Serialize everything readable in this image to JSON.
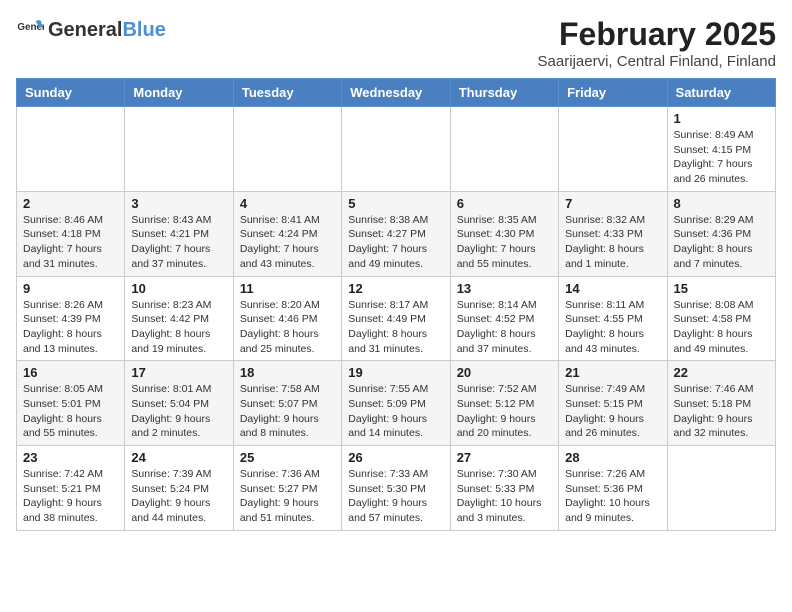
{
  "logo": {
    "general": "General",
    "blue": "Blue"
  },
  "title": "February 2025",
  "subtitle": "Saarijaervi, Central Finland, Finland",
  "days_of_week": [
    "Sunday",
    "Monday",
    "Tuesday",
    "Wednesday",
    "Thursday",
    "Friday",
    "Saturday"
  ],
  "weeks": [
    [
      {
        "day": "",
        "info": ""
      },
      {
        "day": "",
        "info": ""
      },
      {
        "day": "",
        "info": ""
      },
      {
        "day": "",
        "info": ""
      },
      {
        "day": "",
        "info": ""
      },
      {
        "day": "",
        "info": ""
      },
      {
        "day": "1",
        "info": "Sunrise: 8:49 AM\nSunset: 4:15 PM\nDaylight: 7 hours and 26 minutes."
      }
    ],
    [
      {
        "day": "2",
        "info": "Sunrise: 8:46 AM\nSunset: 4:18 PM\nDaylight: 7 hours and 31 minutes."
      },
      {
        "day": "3",
        "info": "Sunrise: 8:43 AM\nSunset: 4:21 PM\nDaylight: 7 hours and 37 minutes."
      },
      {
        "day": "4",
        "info": "Sunrise: 8:41 AM\nSunset: 4:24 PM\nDaylight: 7 hours and 43 minutes."
      },
      {
        "day": "5",
        "info": "Sunrise: 8:38 AM\nSunset: 4:27 PM\nDaylight: 7 hours and 49 minutes."
      },
      {
        "day": "6",
        "info": "Sunrise: 8:35 AM\nSunset: 4:30 PM\nDaylight: 7 hours and 55 minutes."
      },
      {
        "day": "7",
        "info": "Sunrise: 8:32 AM\nSunset: 4:33 PM\nDaylight: 8 hours and 1 minute."
      },
      {
        "day": "8",
        "info": "Sunrise: 8:29 AM\nSunset: 4:36 PM\nDaylight: 8 hours and 7 minutes."
      }
    ],
    [
      {
        "day": "9",
        "info": "Sunrise: 8:26 AM\nSunset: 4:39 PM\nDaylight: 8 hours and 13 minutes."
      },
      {
        "day": "10",
        "info": "Sunrise: 8:23 AM\nSunset: 4:42 PM\nDaylight: 8 hours and 19 minutes."
      },
      {
        "day": "11",
        "info": "Sunrise: 8:20 AM\nSunset: 4:46 PM\nDaylight: 8 hours and 25 minutes."
      },
      {
        "day": "12",
        "info": "Sunrise: 8:17 AM\nSunset: 4:49 PM\nDaylight: 8 hours and 31 minutes."
      },
      {
        "day": "13",
        "info": "Sunrise: 8:14 AM\nSunset: 4:52 PM\nDaylight: 8 hours and 37 minutes."
      },
      {
        "day": "14",
        "info": "Sunrise: 8:11 AM\nSunset: 4:55 PM\nDaylight: 8 hours and 43 minutes."
      },
      {
        "day": "15",
        "info": "Sunrise: 8:08 AM\nSunset: 4:58 PM\nDaylight: 8 hours and 49 minutes."
      }
    ],
    [
      {
        "day": "16",
        "info": "Sunrise: 8:05 AM\nSunset: 5:01 PM\nDaylight: 8 hours and 55 minutes."
      },
      {
        "day": "17",
        "info": "Sunrise: 8:01 AM\nSunset: 5:04 PM\nDaylight: 9 hours and 2 minutes."
      },
      {
        "day": "18",
        "info": "Sunrise: 7:58 AM\nSunset: 5:07 PM\nDaylight: 9 hours and 8 minutes."
      },
      {
        "day": "19",
        "info": "Sunrise: 7:55 AM\nSunset: 5:09 PM\nDaylight: 9 hours and 14 minutes."
      },
      {
        "day": "20",
        "info": "Sunrise: 7:52 AM\nSunset: 5:12 PM\nDaylight: 9 hours and 20 minutes."
      },
      {
        "day": "21",
        "info": "Sunrise: 7:49 AM\nSunset: 5:15 PM\nDaylight: 9 hours and 26 minutes."
      },
      {
        "day": "22",
        "info": "Sunrise: 7:46 AM\nSunset: 5:18 PM\nDaylight: 9 hours and 32 minutes."
      }
    ],
    [
      {
        "day": "23",
        "info": "Sunrise: 7:42 AM\nSunset: 5:21 PM\nDaylight: 9 hours and 38 minutes."
      },
      {
        "day": "24",
        "info": "Sunrise: 7:39 AM\nSunset: 5:24 PM\nDaylight: 9 hours and 44 minutes."
      },
      {
        "day": "25",
        "info": "Sunrise: 7:36 AM\nSunset: 5:27 PM\nDaylight: 9 hours and 51 minutes."
      },
      {
        "day": "26",
        "info": "Sunrise: 7:33 AM\nSunset: 5:30 PM\nDaylight: 9 hours and 57 minutes."
      },
      {
        "day": "27",
        "info": "Sunrise: 7:30 AM\nSunset: 5:33 PM\nDaylight: 10 hours and 3 minutes."
      },
      {
        "day": "28",
        "info": "Sunrise: 7:26 AM\nSunset: 5:36 PM\nDaylight: 10 hours and 9 minutes."
      },
      {
        "day": "",
        "info": ""
      }
    ]
  ]
}
